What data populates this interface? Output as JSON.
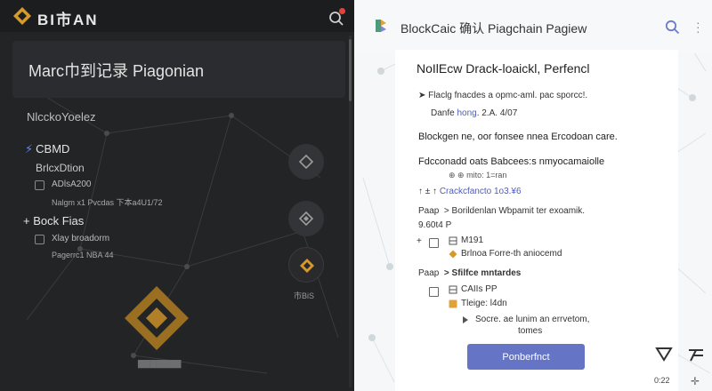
{
  "left": {
    "brand": "BI市AN",
    "hero_title": "Marc巾到记录 Piagonian",
    "section_title": "NlcckoYoelez",
    "group1": {
      "head": "CBMD",
      "sub": "BrlcxDtion",
      "row1_text": "ADlsA200",
      "row1_sub": "Nalgm x1 Pvcdas 下本a4U1/72"
    },
    "group2": {
      "head": "+ Bock Fias",
      "row1_text": "Xlay broadorm",
      "row1_sub": "Pagerrc1 NBA 44"
    },
    "side_caption": "市BiS"
  },
  "right": {
    "header_title": "BlockCaic 确认 Piagchain Pagiew",
    "card_title": "NoIlEcw Drack-loaickl, Perfencl",
    "line1": "Flaclg fnacdes a opmc-aml. pac sporcc!.",
    "line2_a": "Danfe ",
    "line2_link": "hong",
    "line2_b": ". 2.A. 4/07",
    "bold1": "Blockgen ne, oor fonsee nnea Ercodoan care.",
    "bold2": "Fdcconadd oats Babcees:s nmyocamaiolle",
    "small1": "⊕ ⊕ mito: 1=ran",
    "small2": "",
    "nav1": "↑ ± ↑",
    "nav1_link": "Crackcfancto 1o3.¥6",
    "path1_a": "Paap",
    "path1_b": "> Borildenlan Wbpamit ter exoamik.",
    "date1": "9.60t4 P",
    "sub1_plus": "+",
    "sub1_line1": "M191",
    "sub1_line2": "Brlnoa Forre-th aniocemd",
    "path2_a": "Paap",
    "path2_b": "> Sfilfce mntardes",
    "sub2_line1": "CAIIs PP",
    "sub2_line2": "Tleige: l4dn",
    "sub2_line3": "Socre. ae lunim an errvetom,",
    "sub2_line4": "tomes",
    "primary_button": "Ponberfnct"
  },
  "footer": {
    "time": "0:22"
  },
  "colors": {
    "accent_gold": "#d69a2c",
    "primary_blue": "#6574c4",
    "link_blue": "#4b5cc4"
  }
}
